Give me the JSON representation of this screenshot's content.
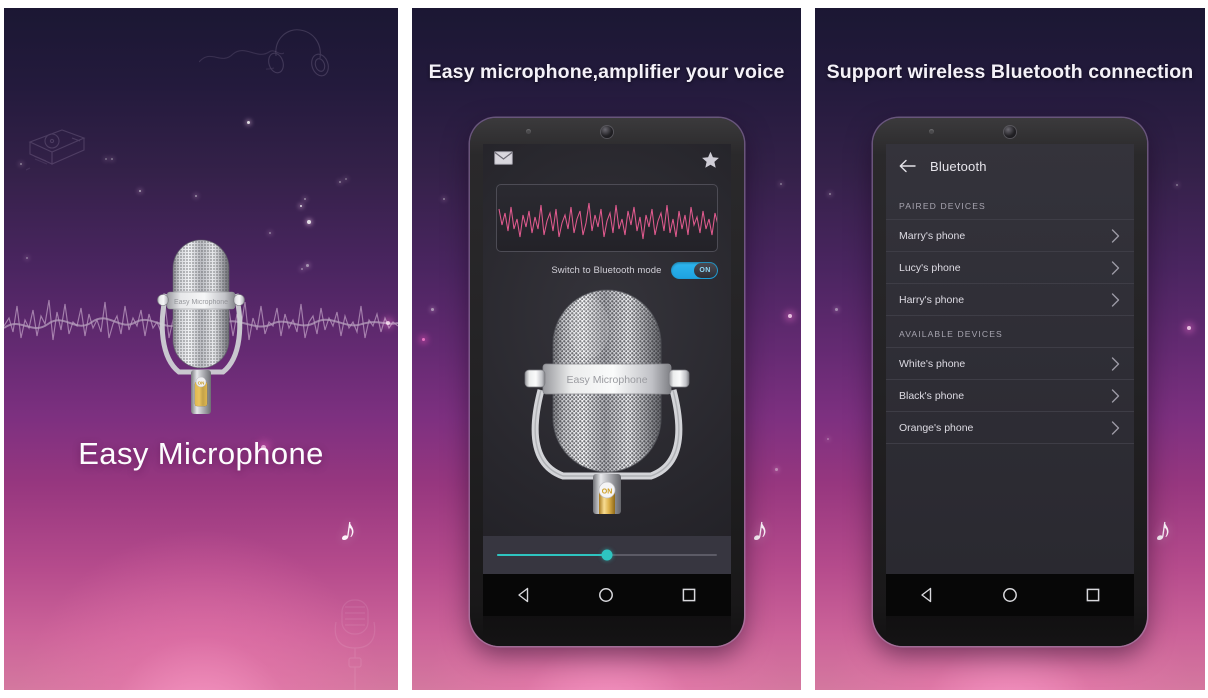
{
  "meta": {
    "app_name": "Easy Microphone",
    "screens": 3,
    "background_top_color": "#1b1733",
    "background_bottom_color": "#d4789f",
    "accent_blue": "#2fb6ef",
    "accent_teal": "#2ec4c0"
  },
  "panel_1": {
    "app_title": "Easy Microphone",
    "mic_label": "Easy Microphone",
    "note_icon": "music-note-icon",
    "decor": {
      "headphones_icon": "headphones-line-art-icon",
      "turntable_icon": "turntable-line-art-icon",
      "ghost_mic_icon": "vintage-microphone-watermark-icon",
      "waveform": "audio-waveform-decoration"
    }
  },
  "panel_2": {
    "headline": "Easy microphone,amplifier your voice",
    "note_icon": "music-note-icon",
    "app": {
      "mail_icon": "mail-icon",
      "star_icon": "star-icon",
      "waveform_title": "live-audio-waveform",
      "bluetooth_toggle": {
        "label": "Switch to Bluetooth mode",
        "state": "ON",
        "enabled": true,
        "color": "#2fb6ef"
      },
      "mic_label": "Easy Microphone",
      "power_switch_label": "ON",
      "volume_slider": {
        "value": 50,
        "min": 0,
        "max": 100,
        "color": "#2ec4c0"
      }
    },
    "navbar": {
      "back_icon": "triangle-back-icon",
      "home_icon": "circle-home-icon",
      "recents_icon": "square-recents-icon"
    }
  },
  "panel_3": {
    "headline": "Support wireless Bluetooth connection",
    "note_icon": "music-note-icon",
    "bluetooth": {
      "back_icon": "arrow-back-icon",
      "title": "Bluetooth",
      "sections": [
        {
          "heading": "PAIRED DEVICES",
          "devices": [
            {
              "name": "Marry's phone"
            },
            {
              "name": "Lucy's phone"
            },
            {
              "name": "Harry's phone"
            }
          ]
        },
        {
          "heading": "AVAILABLE DEVICES",
          "devices": [
            {
              "name": "White's phone"
            },
            {
              "name": "Black's phone"
            },
            {
              "name": "Orange's phone"
            }
          ]
        }
      ]
    },
    "navbar": {
      "back_icon": "triangle-back-icon",
      "home_icon": "circle-home-icon",
      "recents_icon": "square-recents-icon"
    }
  }
}
